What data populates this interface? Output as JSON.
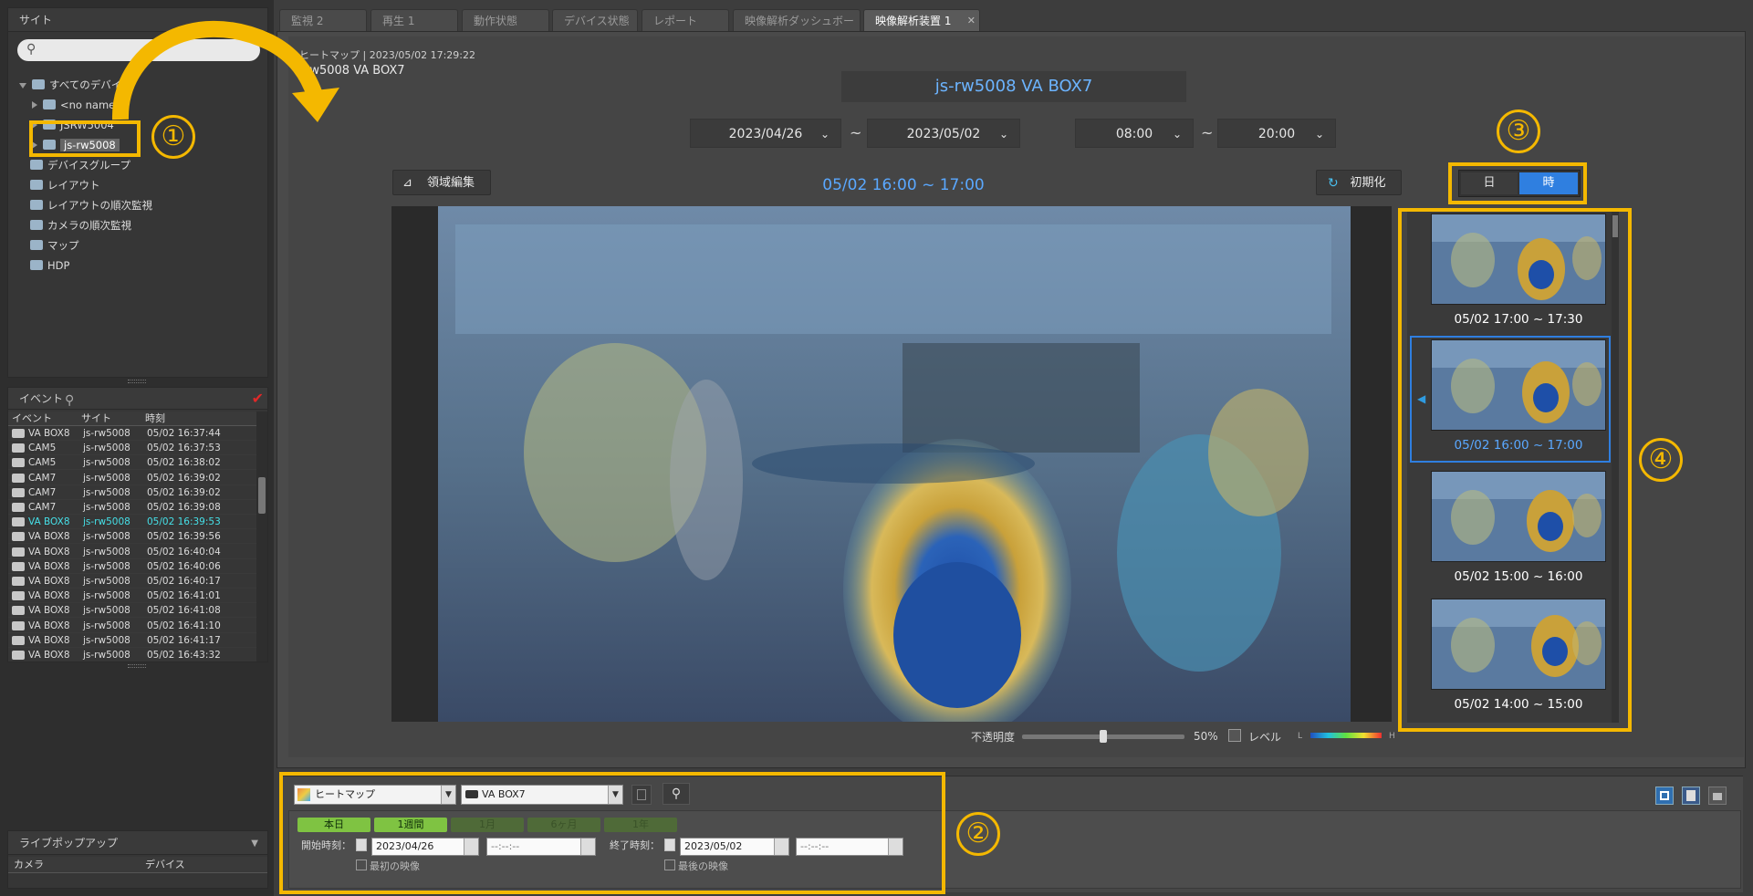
{
  "left": {
    "site_title": "サイト",
    "tree": [
      {
        "label": "すべてのデバイス",
        "level": 0,
        "expanded": true
      },
      {
        "label": "<no name>",
        "level": 1
      },
      {
        "label": "JSRW5004",
        "level": 1
      },
      {
        "label": "js-rw5008",
        "level": 1,
        "selected": true
      },
      {
        "label": "デバイスグループ",
        "level": 0
      },
      {
        "label": "レイアウト",
        "level": 0
      },
      {
        "label": "レイアウトの順次監視",
        "level": 0
      },
      {
        "label": "カメラの順次監視",
        "level": 0
      },
      {
        "label": "マップ",
        "level": 0
      },
      {
        "label": "HDP",
        "level": 0
      }
    ],
    "event_title": "イベント",
    "event_columns": [
      "イベント",
      "サイト",
      "時刻"
    ],
    "events": [
      {
        "event": "VA BOX8",
        "site": "js-rw5008",
        "time": "05/02 16:37:44"
      },
      {
        "event": "CAM5",
        "site": "js-rw5008",
        "time": "05/02 16:37:53"
      },
      {
        "event": "CAM5",
        "site": "js-rw5008",
        "time": "05/02 16:38:02"
      },
      {
        "event": "CAM7",
        "site": "js-rw5008",
        "time": "05/02 16:39:02"
      },
      {
        "event": "CAM7",
        "site": "js-rw5008",
        "time": "05/02 16:39:02"
      },
      {
        "event": "CAM7",
        "site": "js-rw5008",
        "time": "05/02 16:39:08"
      },
      {
        "event": "VA BOX8",
        "site": "js-rw5008",
        "time": "05/02 16:39:53",
        "highlight": true
      },
      {
        "event": "VA BOX8",
        "site": "js-rw5008",
        "time": "05/02 16:39:56"
      },
      {
        "event": "VA BOX8",
        "site": "js-rw5008",
        "time": "05/02 16:40:04"
      },
      {
        "event": "VA BOX8",
        "site": "js-rw5008",
        "time": "05/02 16:40:06"
      },
      {
        "event": "VA BOX8",
        "site": "js-rw5008",
        "time": "05/02 16:40:17"
      },
      {
        "event": "VA BOX8",
        "site": "js-rw5008",
        "time": "05/02 16:41:01"
      },
      {
        "event": "VA BOX8",
        "site": "js-rw5008",
        "time": "05/02 16:41:08"
      },
      {
        "event": "VA BOX8",
        "site": "js-rw5008",
        "time": "05/02 16:41:10"
      },
      {
        "event": "VA BOX8",
        "site": "js-rw5008",
        "time": "05/02 16:41:17"
      },
      {
        "event": "VA BOX8",
        "site": "js-rw5008",
        "time": "05/02 16:43:32"
      }
    ],
    "live_popup_title": "ライブポップアップ",
    "live_popup_columns": [
      "カメラ",
      "デバイス"
    ]
  },
  "tabs": [
    "監視 2",
    "再生 1",
    "動作状態",
    "デバイス状態",
    "レポート",
    "映像解析ダッシュボード",
    "映像解析装置 1"
  ],
  "active_tab": 6,
  "header": {
    "line1": "ヒートマップ | 2023/05/02 17:29:22",
    "line2": "rw5008  VA BOX7",
    "device_title": "js-rw5008 VA BOX7"
  },
  "range": {
    "date_from": "2023/04/26",
    "date_to": "2023/05/02",
    "time_from": "08:00",
    "time_to": "20:00",
    "tilde": "~"
  },
  "toolbar": {
    "edit_area": "領域編集",
    "current_period": "05/02 16:00 ~ 17:00",
    "reset": "初期化",
    "day": "日",
    "hour": "時"
  },
  "thumbnails": [
    {
      "label": "05/02 17:00 ~ 17:30"
    },
    {
      "label": "05/02 16:00 ~ 17:00",
      "selected": true
    },
    {
      "label": "05/02 15:00 ~ 16:00"
    },
    {
      "label": "05/02 14:00 ~ 15:00"
    }
  ],
  "opacity": {
    "label": "不透明度",
    "value_text": "50%",
    "value": 0.5,
    "level_label": "レベル",
    "legend_low": "L",
    "legend_high": "H"
  },
  "bottom": {
    "type_select": "ヒートマップ",
    "device_select": "VA BOX7",
    "quick": [
      "本日",
      "1週間",
      "1月",
      "6ヶ月",
      "1年"
    ],
    "start_label": "開始時刻：",
    "start_date": "2023/04/26",
    "start_time": "--:--:--",
    "end_label": "終了時刻：",
    "end_date": "2023/05/02",
    "end_time": "--:--:--",
    "first_video": "最初の映像",
    "last_video": "最後の映像"
  },
  "annotations": [
    "①",
    "②",
    "③",
    "④"
  ],
  "colors": {
    "accent": "#f4b800",
    "selected_blue": "#2f7fe0",
    "period_text": "#5aa8ff",
    "highlight_event": "#46e0e8"
  }
}
